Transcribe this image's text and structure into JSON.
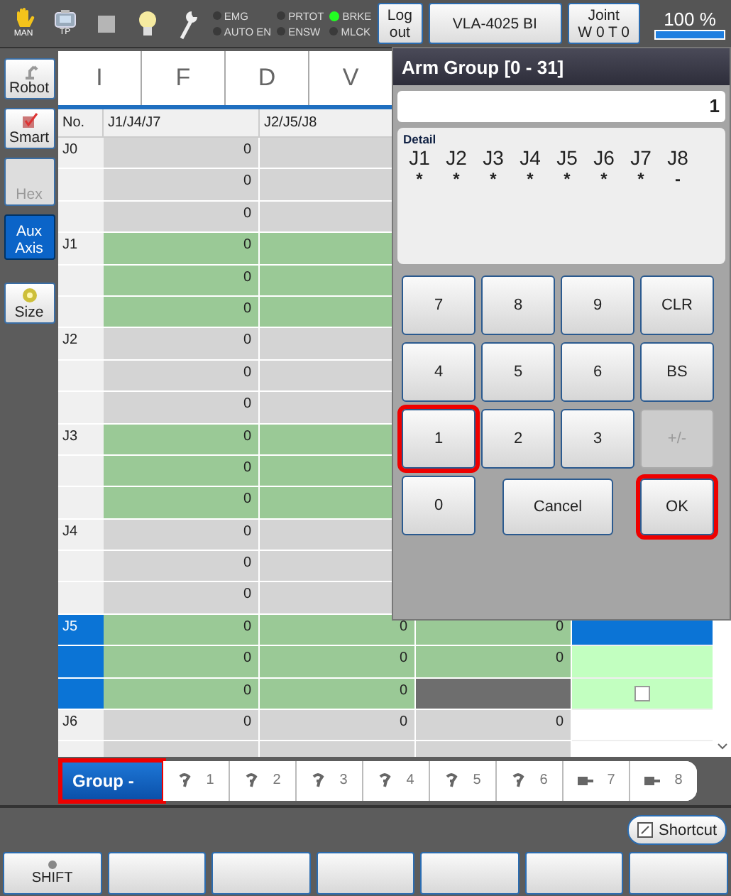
{
  "top_bar": {
    "mode_icons": [
      {
        "kind": "hand",
        "label": "MAN"
      },
      {
        "kind": "tp",
        "label": "TP"
      },
      {
        "kind": "square"
      },
      {
        "kind": "bulb"
      },
      {
        "kind": "wrench"
      }
    ],
    "status_lights": [
      {
        "label": "EMG",
        "on": false
      },
      {
        "label": "AUTO EN",
        "on": false
      },
      {
        "label": "PRTOT",
        "on": false
      },
      {
        "label": "ENSW",
        "on": false
      },
      {
        "label": "BRKE",
        "on": true
      },
      {
        "label": "MLCK",
        "on": false
      }
    ],
    "buttons": [
      {
        "label": "Log\nout",
        "kind": "narrow"
      },
      {
        "label": "VLA-4025 BI",
        "kind": "wide"
      },
      {
        "label": "Joint\nW 0 T 0",
        "kind": "medium"
      }
    ],
    "speed": {
      "reading": "100 %",
      "level": 1.0
    }
  },
  "sidebar": {
    "items": [
      {
        "label": "Robot",
        "kind": "robot",
        "selected": false,
        "disabled": false
      },
      {
        "label": "Smart",
        "kind": "smart",
        "selected": false,
        "disabled": false
      },
      {
        "label": "Hex",
        "kind": "text",
        "selected": false,
        "disabled": true
      },
      {
        "label": "Aux\nAxis",
        "kind": "text",
        "selected": true,
        "disabled": false
      },
      {
        "label": "Size",
        "kind": "size",
        "selected": false,
        "disabled": false
      }
    ]
  },
  "tabs": [
    {
      "label": "I"
    },
    {
      "label": "F"
    },
    {
      "label": "D"
    },
    {
      "label": "V"
    }
  ],
  "table": {
    "columns": [
      "No.",
      "J1/J4/J7",
      "J2/J5/J8"
    ],
    "rows": [
      {
        "no": "J0",
        "kind": "normal",
        "selected": false,
        "cells": [
          "0"
        ]
      },
      {
        "kind": "normal",
        "selected": false,
        "cells": [
          "0"
        ]
      },
      {
        "kind": "normal",
        "selected": false,
        "cells": [
          "0"
        ]
      },
      {
        "no": "J1",
        "kind": "active",
        "selected": false,
        "cells": [
          "0"
        ]
      },
      {
        "kind": "active",
        "selected": false,
        "cells": [
          "0"
        ]
      },
      {
        "kind": "active",
        "selected": false,
        "cells": [
          "0"
        ]
      },
      {
        "no": "J2",
        "kind": "normal",
        "selected": false,
        "cells": [
          "0"
        ]
      },
      {
        "kind": "normal",
        "selected": false,
        "cells": [
          "0"
        ]
      },
      {
        "kind": "normal",
        "selected": false,
        "cells": [
          "0"
        ]
      },
      {
        "no": "J3",
        "kind": "active",
        "selected": false,
        "cells": [
          "0"
        ]
      },
      {
        "kind": "active",
        "selected": false,
        "cells": [
          "0"
        ]
      },
      {
        "kind": "active",
        "selected": false,
        "cells": [
          "0"
        ]
      },
      {
        "no": "J4",
        "kind": "normal",
        "selected": false,
        "cells": [
          "0"
        ]
      },
      {
        "kind": "normal",
        "selected": false,
        "cells": [
          "0"
        ]
      },
      {
        "kind": "normal",
        "selected": false,
        "cells": [
          "0"
        ]
      },
      {
        "no": "J5",
        "kind": "active",
        "selected": true,
        "cells": [
          "0",
          "0",
          "0"
        ],
        "j3_disabled": false,
        "col5": {
          "kind": "highlight"
        }
      },
      {
        "kind": "active",
        "selected": true,
        "cells": [
          "0",
          "0",
          "0"
        ],
        "j3_disabled": false,
        "col5": {
          "kind": "light"
        }
      },
      {
        "kind": "active",
        "selected": true,
        "cells": [
          "0",
          "0"
        ],
        "j3_disabled": true,
        "col5": {
          "kind": "checkbox",
          "checked": false
        }
      },
      {
        "no": "J6",
        "kind": "normal",
        "selected": false,
        "cells": [
          "0",
          "0",
          "0"
        ],
        "j3_disabled": false,
        "col5": {
          "kind": "plain"
        }
      },
      {
        "kind": "normal",
        "selected": false,
        "cells": []
      }
    ]
  },
  "group_bar": {
    "group_button": {
      "label": "Group -",
      "highlighted": true
    },
    "tabs": [
      {
        "label": "1",
        "kind": "arm"
      },
      {
        "label": "2",
        "kind": "arm"
      },
      {
        "label": "3",
        "kind": "arm"
      },
      {
        "label": "4",
        "kind": "arm"
      },
      {
        "label": "5",
        "kind": "arm"
      },
      {
        "label": "6",
        "kind": "arm"
      },
      {
        "label": "7",
        "kind": "motor"
      },
      {
        "label": "8",
        "kind": "motor"
      }
    ]
  },
  "dialog": {
    "title": "Arm Group [0 - 31]",
    "value": "1",
    "detail_label": "Detail",
    "joints": [
      {
        "name": "J1",
        "mark": "*"
      },
      {
        "name": "J2",
        "mark": "*"
      },
      {
        "name": "J3",
        "mark": "*"
      },
      {
        "name": "J4",
        "mark": "*"
      },
      {
        "name": "J5",
        "mark": "*"
      },
      {
        "name": "J6",
        "mark": "*"
      },
      {
        "name": "J7",
        "mark": "*"
      },
      {
        "name": "J8",
        "mark": "-"
      }
    ],
    "keys": [
      {
        "label": "7",
        "disabled": false,
        "highlighted": false
      },
      {
        "label": "8",
        "disabled": false,
        "highlighted": false
      },
      {
        "label": "9",
        "disabled": false,
        "highlighted": false
      },
      {
        "label": "CLR",
        "disabled": false,
        "highlighted": false
      },
      {
        "label": "4",
        "disabled": false,
        "highlighted": false
      },
      {
        "label": "5",
        "disabled": false,
        "highlighted": false
      },
      {
        "label": "6",
        "disabled": false,
        "highlighted": false
      },
      {
        "label": "BS",
        "disabled": false,
        "highlighted": false
      },
      {
        "label": "1",
        "disabled": false,
        "highlighted": true
      },
      {
        "label": "2",
        "disabled": false,
        "highlighted": false
      },
      {
        "label": "3",
        "disabled": false,
        "highlighted": false
      },
      {
        "label": "+/-",
        "disabled": true,
        "highlighted": false
      },
      {
        "label": "0",
        "disabled": false,
        "highlighted": false
      }
    ],
    "cancel": {
      "label": "Cancel",
      "highlighted": false
    },
    "ok": {
      "label": "OK",
      "highlighted": true
    }
  },
  "shortcut": {
    "label": "Shortcut"
  },
  "function_keys": [
    "SHIFT"
  ]
}
